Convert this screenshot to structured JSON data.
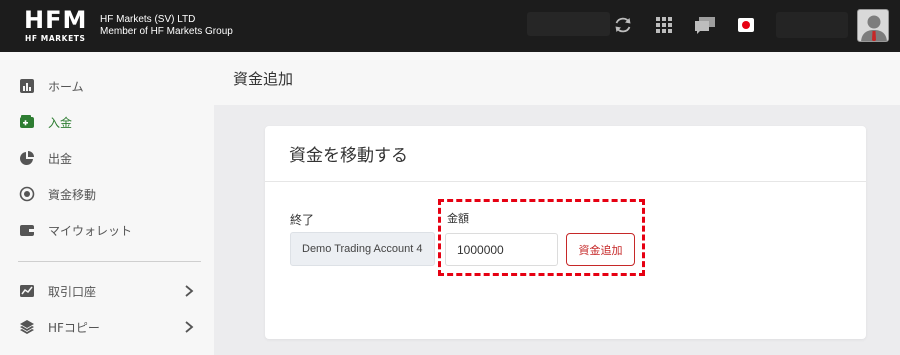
{
  "header": {
    "logo_text": "HFM",
    "logo_sub": "HF MARKETS",
    "company_line1": "HF Markets (SV) LTD",
    "company_line2": "Member of HF Markets Group"
  },
  "sidebar": {
    "items": [
      {
        "label": "ホーム",
        "icon": "chart-bar-icon"
      },
      {
        "label": "入金",
        "icon": "wallet-add-icon",
        "active": true
      },
      {
        "label": "出金",
        "icon": "pie-chart-icon"
      },
      {
        "label": "資金移動",
        "icon": "transfer-icon"
      },
      {
        "label": "マイウォレット",
        "icon": "wallet-icon"
      },
      {
        "label": "取引口座",
        "icon": "trading-chart-icon"
      },
      {
        "label": "HFコピー",
        "icon": "layers-icon"
      }
    ]
  },
  "page": {
    "title": "資金追加"
  },
  "card": {
    "title": "資金を移動する",
    "end_label": "終了",
    "account_value": "Demo Trading Account 4",
    "amount_label": "金額",
    "amount_value": "1000000",
    "add_button": "資金追加"
  },
  "colors": {
    "topbar": "#1c1c1c",
    "accent_red": "#c62828",
    "highlight": "#e60012",
    "active_green": "#2e7d32"
  }
}
